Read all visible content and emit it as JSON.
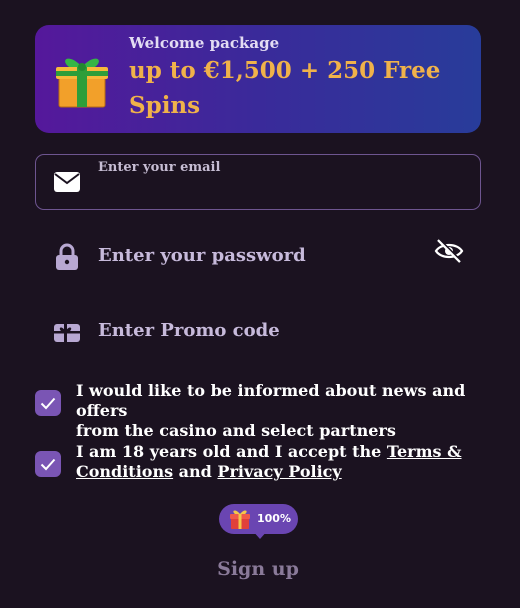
{
  "welcome": {
    "subtitle": "Welcome package",
    "title": "up to €1,500 + 250 Free Spins",
    "icon": "gift-box-icon"
  },
  "email": {
    "placeholder": "Enter your email",
    "icon": "envelope-icon"
  },
  "password": {
    "placeholder": "Enter your password",
    "icon": "lock-icon",
    "toggle_icon": "eye-slash-icon"
  },
  "promo": {
    "placeholder": "Enter Promo code",
    "icon": "gift-card-icon"
  },
  "consents": {
    "news": {
      "checked": true,
      "line1": "I would like to be informed about news and offers",
      "line2": "from the casino and select partners"
    },
    "terms": {
      "checked": true,
      "prefix": "I am 18 years old and I accept the ",
      "terms_link_1": "Terms &",
      "terms_link_2": "Conditions",
      "and": " and ",
      "privacy_link": "Privacy Policy"
    }
  },
  "badge": {
    "text": "100%",
    "icon": "gift-icon"
  },
  "signup": {
    "label": "Sign up"
  },
  "colors": {
    "background": "#1b1220",
    "accent_gold": "#f0b24a",
    "checkbox": "#7a55b4",
    "banner_start": "#55189b",
    "banner_end": "#283c9a"
  }
}
